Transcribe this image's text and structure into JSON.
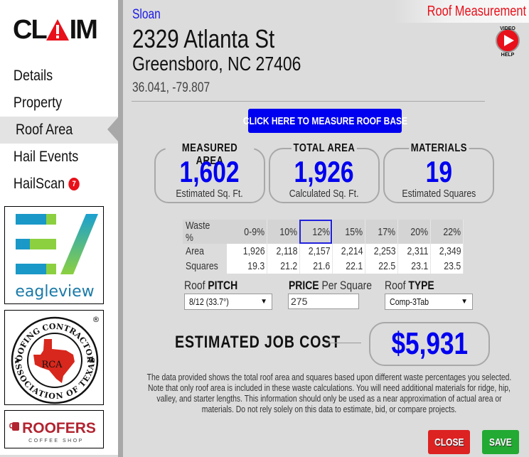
{
  "app": {
    "logo_text_left": "CL",
    "logo_text_right": "IM",
    "page_title": "Roof Measurement",
    "video_help": {
      "top": "VIDEO",
      "bottom": "HELP"
    }
  },
  "sidebar": {
    "items": [
      {
        "label": "Details",
        "active": false
      },
      {
        "label": "Property",
        "active": false
      },
      {
        "label": "Roof Area",
        "active": true
      },
      {
        "label": "Hail Events",
        "active": false
      },
      {
        "label": "HailScan",
        "active": false,
        "badge": "7"
      }
    ],
    "partners": [
      {
        "name": "eagleview",
        "text": "eagleview"
      },
      {
        "name": "rca",
        "top_text": "ROOFING CONTRACTORS",
        "bottom_text": "ASSOCIATION OF TEXAS",
        "center_text": "RCA",
        "mark": "®"
      },
      {
        "name": "roofers-coffee-shop",
        "text": "ROOFERS",
        "sub": "COFFEE SHOP"
      }
    ]
  },
  "property": {
    "owner": "Sloan",
    "address_line1": "2329 Atlanta St",
    "address_line2": "Greensboro, NC 27406",
    "coordinates": "36.041, -79.807"
  },
  "actions": {
    "measure_button": "CLICK HERE TO MEASURE ROOF BASE",
    "close": "CLOSE",
    "save": "SAVE"
  },
  "cards": [
    {
      "title": "MEASURED AREA",
      "value": "1,602",
      "sub": "Estimated Sq. Ft."
    },
    {
      "title": "TOTAL AREA",
      "value": "1,926",
      "sub": "Calculated Sq. Ft."
    },
    {
      "title": "MATERIALS",
      "value": "19",
      "sub": "Estimated Squares"
    }
  ],
  "waste_table": {
    "row_labels": [
      "Waste %",
      "Area",
      "Squares"
    ],
    "columns": [
      "0-9%",
      "10%",
      "12%",
      "15%",
      "17%",
      "20%",
      "22%"
    ],
    "selected": "12%",
    "area": [
      "1,926",
      "2,118",
      "2,157",
      "2,214",
      "2,253",
      "2,311",
      "2,349"
    ],
    "squares": [
      "19.3",
      "21.2",
      "21.6",
      "22.1",
      "22.5",
      "23.1",
      "23.5"
    ]
  },
  "inputs": {
    "pitch_label_a": "Roof ",
    "pitch_label_b": "PITCH",
    "pitch_value": "8/12 (33.7°)",
    "price_label_a": "PRICE",
    "price_label_b": " Per Square",
    "price_value": "275",
    "type_label_a": "Roof ",
    "type_label_b": "TYPE",
    "type_value": "Comp-3Tab"
  },
  "estimate": {
    "label": "ESTIMATED JOB COST",
    "value": "$5,931"
  },
  "disclaimer": "The data provided shows the total roof area and squares based upon different waste percentages you selected. Note that only roof area is included in these waste calculations. You will need additional materials for ridge, hip, valley, and starter lengths. This information should only be used as a near approximation of actual area or materials. Do not rely solely on this data to estimate, bid, or compare projects.",
  "colors": {
    "accent_blue": "#0000f0",
    "title_red": "#e8101a",
    "close_red": "#dd2222",
    "save_green": "#22aa33"
  }
}
